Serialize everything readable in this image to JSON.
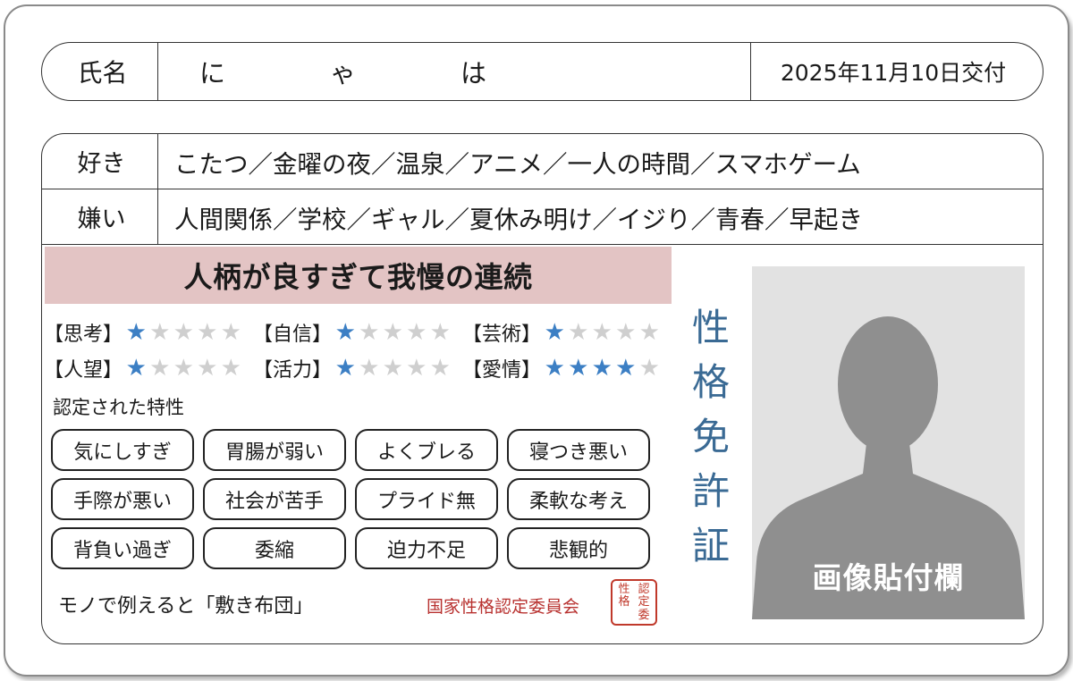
{
  "card": {
    "name_label": "氏名",
    "name_chars": [
      "に",
      "ゃ",
      "は"
    ],
    "issue_date": "2025年11月10日交付"
  },
  "preferences": {
    "likes_label": "好き",
    "likes": "こたつ／金曜の夜／温泉／アニメ／一人の時間／スマホゲーム",
    "dislikes_label": "嫌い",
    "dislikes": "人間関係／学校／ギャル／夏休み明け／イジり／青春／早起き"
  },
  "headline": "人柄が良すぎて我慢の連続",
  "ratings": [
    {
      "label": "【思考】",
      "stars": 1,
      "max": 5
    },
    {
      "label": "【自信】",
      "stars": 1,
      "max": 5
    },
    {
      "label": "【芸術】",
      "stars": 1,
      "max": 5
    },
    {
      "label": "【人望】",
      "stars": 1,
      "max": 5
    },
    {
      "label": "【活力】",
      "stars": 1,
      "max": 5
    },
    {
      "label": "【愛情】",
      "stars": 4,
      "max": 5
    }
  ],
  "traits_title": "認定された特性",
  "traits": [
    "気にしすぎ",
    "胃腸が弱い",
    "よくブレる",
    "寝つき悪い",
    "手際が悪い",
    "社会が苦手",
    "プライド無",
    "柔軟な考え",
    "背負い過ぎ",
    "委縮",
    "迫力不足",
    "悲観的"
  ],
  "mono": "モノで例えると「敷き布団」",
  "committee": "国家性格認定委員会",
  "seal": [
    "認",
    "性",
    "定",
    "格",
    "委",
    ""
  ],
  "vertical_title": [
    "性",
    "格",
    "免",
    "許",
    "証"
  ],
  "photo_label": "画像貼付欄",
  "colors": {
    "star_on": "#3c7fc4",
    "star_off": "#cfcfcf",
    "headline_bg": "#e3c4c4",
    "title_blue": "#3a6a94",
    "seal_red": "#c0392b"
  }
}
